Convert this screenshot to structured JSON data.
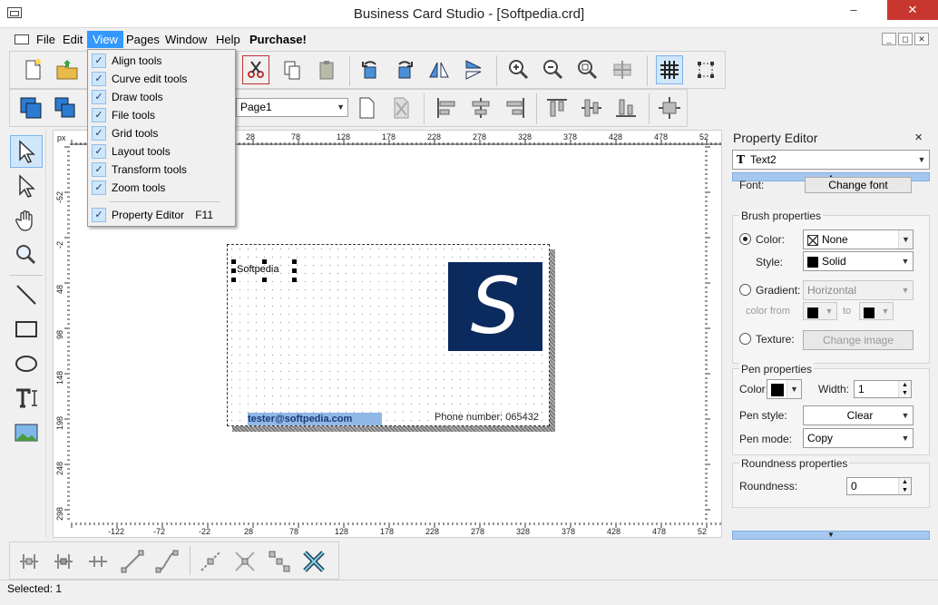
{
  "window": {
    "title": "Business Card Studio - [Softpedia.crd]",
    "minimize": "–",
    "close": "✕"
  },
  "menu": [
    "File",
    "Edit",
    "View",
    "Pages",
    "Window",
    "Help",
    "Purchase!"
  ],
  "mdi": {
    "min": "_",
    "restore": "◻",
    "close": "✕"
  },
  "page_selector": {
    "value": "Page1"
  },
  "view_menu": {
    "items": [
      "Align tools",
      "Curve edit tools",
      "Draw tools",
      "File tools",
      "Grid tools",
      "Layout tools",
      "Transform tools",
      "Zoom tools"
    ],
    "property_editor": {
      "label": "Property Editor",
      "shortcut": "F11"
    },
    "check": "✓"
  },
  "ruler": {
    "unit": "px",
    "top": [
      "28",
      "78",
      "128",
      "178",
      "228",
      "278",
      "328",
      "378",
      "428",
      "478",
      "52"
    ],
    "bottom": [
      "-122",
      "-72",
      "-22",
      "28",
      "78",
      "128",
      "178",
      "228",
      "278",
      "328",
      "378",
      "428",
      "478",
      "52"
    ],
    "left": [
      "-52",
      "-2",
      "48",
      "98",
      "148",
      "198",
      "248",
      "298"
    ]
  },
  "card": {
    "name_text": "Softpedia",
    "email": "tester@softpedia.com",
    "phone": "Phone number: 065432",
    "logo_letter": "S"
  },
  "property_editor": {
    "title": "Property Editor",
    "close": "✕",
    "object": "Text2",
    "object_icon": "T",
    "font_label": "Font:",
    "change_font": "Change font",
    "brush": {
      "title": "Brush properties",
      "color_label": "Color:",
      "color_value": "None",
      "style_label": "Style:",
      "style_value": "Solid",
      "gradient_label": "Gradient:",
      "gradient_value": "Horizontal",
      "color_from_label": "color from",
      "to_label": "to",
      "texture_label": "Texture:",
      "change_image": "Change image"
    },
    "pen": {
      "title": "Pen properties",
      "color_label": "Color:",
      "width_label": "Width:",
      "width_value": "1",
      "style_label": "Pen style:",
      "style_value": "Clear",
      "mode_label": "Pen mode:",
      "mode_value": "Copy"
    },
    "roundness": {
      "title": "Roundness properties",
      "label": "Roundness:",
      "value": "0"
    }
  },
  "status": "Selected: 1",
  "colors": {
    "accent": "#3399ff",
    "logo_bg": "#0b2a5e",
    "email_highlight": "#8fb8e6"
  }
}
